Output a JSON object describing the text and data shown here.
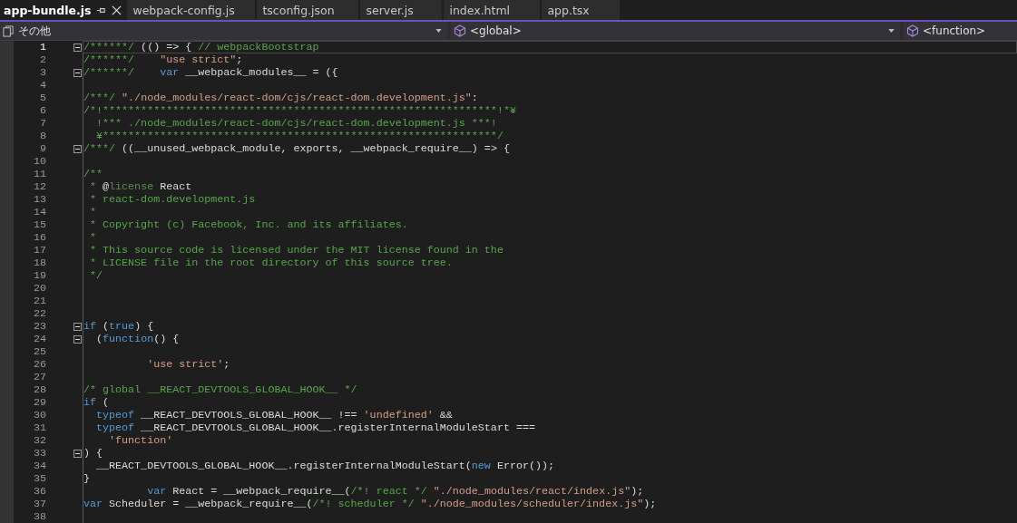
{
  "tabs": [
    {
      "label": "app-bundle.js",
      "selected": true,
      "pinnable": true
    },
    {
      "label": "webpack-config.js",
      "selected": false,
      "pinnable": false
    },
    {
      "label": "tsconfig.json",
      "selected": false,
      "pinnable": false
    },
    {
      "label": "server.js",
      "selected": false,
      "pinnable": false
    },
    {
      "label": "index.html",
      "selected": false,
      "pinnable": false
    },
    {
      "label": "app.tsx",
      "selected": false,
      "pinnable": false
    }
  ],
  "navigation": {
    "project": "その他",
    "scope": "<global>",
    "member": "<function>"
  },
  "lines": [
    {
      "number": "1",
      "foldable": true,
      "current": true,
      "tokens": [
        {
          "kind": "comment",
          "text": "/******/"
        },
        {
          "kind": "plain",
          "text": " (() => { "
        },
        {
          "kind": "comment",
          "text": "// webpackBootstrap"
        }
      ]
    },
    {
      "number": "2",
      "foldable": false,
      "current": false,
      "tokens": [
        {
          "kind": "comment",
          "text": "/******/    "
        },
        {
          "kind": "string",
          "text": "\"use strict\""
        },
        {
          "kind": "plain",
          "text": ";"
        }
      ]
    },
    {
      "number": "3",
      "foldable": true,
      "current": false,
      "tokens": [
        {
          "kind": "comment",
          "text": "/******/    "
        },
        {
          "kind": "keyword",
          "text": "var"
        },
        {
          "kind": "plain",
          "text": " __webpack_modules__ = ({"
        }
      ]
    },
    {
      "number": "4",
      "foldable": false,
      "current": false
    },
    {
      "number": "5",
      "foldable": false,
      "current": false,
      "tokens": [
        {
          "kind": "comment",
          "text": "/***/ "
        },
        {
          "kind": "string",
          "text": "\"./node_modules/react-dom/cjs/react-dom.development.js\""
        },
        {
          "kind": "plain",
          "text": ":"
        }
      ]
    },
    {
      "number": "6",
      "foldable": false,
      "current": false,
      "tokens": [
        {
          "kind": "comment",
          "text": "/*!**************************************************************!*¥"
        }
      ]
    },
    {
      "number": "7",
      "foldable": false,
      "current": false,
      "tokens": [
        {
          "kind": "comment",
          "text": "  !*** ./node_modules/react-dom/cjs/react-dom.development.js ***!"
        }
      ]
    },
    {
      "number": "8",
      "foldable": false,
      "current": false,
      "tokens": [
        {
          "kind": "comment",
          "text": "  ¥**************************************************************/"
        }
      ]
    },
    {
      "number": "9",
      "foldable": true,
      "current": false,
      "tokens": [
        {
          "kind": "comment",
          "text": "/***/"
        },
        {
          "kind": "plain",
          "text": " ((__unused_webpack_module, exports, __webpack_require__) => {"
        }
      ]
    },
    {
      "number": "10",
      "foldable": false,
      "current": false
    },
    {
      "number": "11",
      "foldable": false,
      "current": false,
      "tokens": [
        {
          "kind": "comment",
          "text": "/**"
        }
      ]
    },
    {
      "number": "12",
      "foldable": false,
      "current": false,
      "tokens": [
        {
          "kind": "comment",
          "text": " * "
        },
        {
          "kind": "plain",
          "text": "@"
        },
        {
          "kind": "doctag",
          "text": "license"
        },
        {
          "kind": "plain",
          "text": " React"
        }
      ]
    },
    {
      "number": "13",
      "foldable": false,
      "current": false,
      "tokens": [
        {
          "kind": "comment",
          "text": " * react-dom.development.js"
        }
      ]
    },
    {
      "number": "14",
      "foldable": false,
      "current": false,
      "tokens": [
        {
          "kind": "comment",
          "text": " *"
        }
      ]
    },
    {
      "number": "15",
      "foldable": false,
      "current": false,
      "tokens": [
        {
          "kind": "comment",
          "text": " * Copyright (c) Facebook, Inc. and its affiliates."
        }
      ]
    },
    {
      "number": "16",
      "foldable": false,
      "current": false,
      "tokens": [
        {
          "kind": "comment",
          "text": " *"
        }
      ]
    },
    {
      "number": "17",
      "foldable": false,
      "current": false,
      "tokens": [
        {
          "kind": "comment",
          "text": " * This source code is licensed under the MIT license found in the"
        }
      ]
    },
    {
      "number": "18",
      "foldable": false,
      "current": false,
      "tokens": [
        {
          "kind": "comment",
          "text": " * LICENSE file in the root directory of this source tree."
        }
      ]
    },
    {
      "number": "19",
      "foldable": false,
      "current": false,
      "tokens": [
        {
          "kind": "comment",
          "text": " */"
        }
      ]
    },
    {
      "number": "20",
      "foldable": false,
      "current": false
    },
    {
      "number": "21",
      "foldable": false,
      "current": false
    },
    {
      "number": "22",
      "foldable": false,
      "current": false
    },
    {
      "number": "23",
      "foldable": true,
      "current": false,
      "tokens": [
        {
          "kind": "keyword",
          "text": "if"
        },
        {
          "kind": "plain",
          "text": " ("
        },
        {
          "kind": "keyword",
          "text": "true"
        },
        {
          "kind": "plain",
          "text": ") {"
        }
      ]
    },
    {
      "number": "24",
      "foldable": true,
      "current": false,
      "tokens": [
        {
          "kind": "plain",
          "text": "  ("
        },
        {
          "kind": "keyword",
          "text": "function"
        },
        {
          "kind": "plain",
          "text": "() {"
        }
      ]
    },
    {
      "number": "25",
      "foldable": false,
      "current": false
    },
    {
      "number": "26",
      "foldable": false,
      "current": false,
      "tokens": [
        {
          "kind": "string",
          "text": "          'use strict'"
        },
        {
          "kind": "plain",
          "text": ";"
        }
      ]
    },
    {
      "number": "27",
      "foldable": false,
      "current": false
    },
    {
      "number": "28",
      "foldable": false,
      "current": false,
      "tokens": [
        {
          "kind": "comment",
          "text": "/* global __REACT_DEVTOOLS_GLOBAL_HOOK__ */"
        }
      ]
    },
    {
      "number": "29",
      "foldable": false,
      "current": false,
      "tokens": [
        {
          "kind": "keyword",
          "text": "if"
        },
        {
          "kind": "plain",
          "text": " ("
        }
      ]
    },
    {
      "number": "30",
      "foldable": false,
      "current": false,
      "tokens": [
        {
          "kind": "keyword",
          "text": "  typeof"
        },
        {
          "kind": "plain",
          "text": " __REACT_DEVTOOLS_GLOBAL_HOOK__ !== "
        },
        {
          "kind": "string",
          "text": "'undefined'"
        },
        {
          "kind": "plain",
          "text": " &&"
        }
      ]
    },
    {
      "number": "31",
      "foldable": false,
      "current": false,
      "tokens": [
        {
          "kind": "keyword",
          "text": "  typeof"
        },
        {
          "kind": "plain",
          "text": " __REACT_DEVTOOLS_GLOBAL_HOOK__.registerInternalModuleStart ==="
        }
      ]
    },
    {
      "number": "32",
      "foldable": false,
      "current": false,
      "tokens": [
        {
          "kind": "string",
          "text": "    'function'"
        }
      ]
    },
    {
      "number": "33",
      "foldable": true,
      "current": false,
      "tokens": [
        {
          "kind": "plain",
          "text": ") {"
        }
      ]
    },
    {
      "number": "34",
      "foldable": false,
      "current": false,
      "tokens": [
        {
          "kind": "plain",
          "text": "  __REACT_DEVTOOLS_GLOBAL_HOOK__.registerInternalModuleStart("
        },
        {
          "kind": "keyword",
          "text": "new"
        },
        {
          "kind": "plain",
          "text": " Error());"
        }
      ]
    },
    {
      "number": "35",
      "foldable": false,
      "current": false,
      "tokens": [
        {
          "kind": "plain",
          "text": "}"
        }
      ]
    },
    {
      "number": "36",
      "foldable": false,
      "current": false,
      "tokens": [
        {
          "kind": "keyword",
          "text": "          var"
        },
        {
          "kind": "plain",
          "text": " React = __webpack_require__("
        },
        {
          "kind": "comment",
          "text": "/*! react */ "
        },
        {
          "kind": "string",
          "text": "\"./node_modules/react/index.js\""
        },
        {
          "kind": "plain",
          "text": ");"
        }
      ]
    },
    {
      "number": "37",
      "foldable": false,
      "current": false,
      "tokens": [
        {
          "kind": "keyword",
          "text": "var"
        },
        {
          "kind": "plain",
          "text": " Scheduler = __webpack_require__("
        },
        {
          "kind": "comment",
          "text": "/*! scheduler */ "
        },
        {
          "kind": "string",
          "text": "\"./node_modules/scheduler/index.js\""
        },
        {
          "kind": "plain",
          "text": ");"
        }
      ]
    },
    {
      "number": "38",
      "foldable": false,
      "current": false
    }
  ]
}
